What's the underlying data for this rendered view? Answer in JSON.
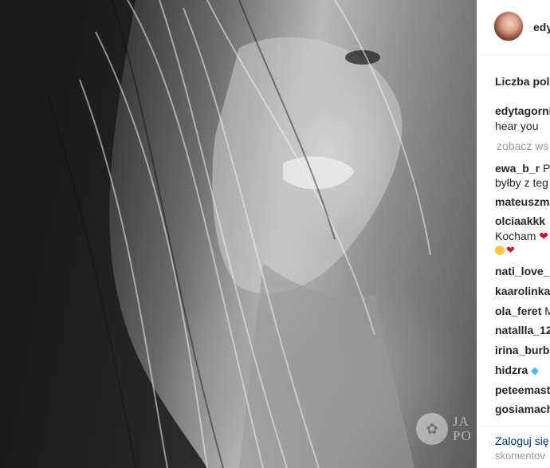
{
  "post": {
    "author_username": "edy",
    "likes_label": "Liczba polu",
    "view_all_label": "zobacz ws",
    "comments": [
      {
        "user": "edytagorni",
        "text": "",
        "line2": "hear you"
      },
      {
        "user": "ewa_b_r",
        "text": "P",
        "line2": "byłby z teg"
      },
      {
        "user": "mateuszma",
        "text": ""
      },
      {
        "user": "olciaakkk",
        "text": "",
        "line2": "Kocham"
      },
      {
        "user": "nati_love_",
        "text": ""
      },
      {
        "user": "kaarolinka",
        "text": ""
      },
      {
        "user": "ola_feret",
        "text": "M"
      },
      {
        "user": "natallla_12",
        "text": ""
      },
      {
        "user": "irina_burbo",
        "text": ""
      },
      {
        "user": "hidzra",
        "text": ""
      },
      {
        "user": "peteemast",
        "text": ""
      },
      {
        "user": "gosiamach",
        "text": ""
      }
    ]
  },
  "footer": {
    "login_label": "Zaloguj się",
    "login_sub": "skomentov"
  },
  "watermark": {
    "line1": "JA",
    "line2": "PO"
  },
  "icons": {
    "heart": "heart-icon",
    "gem": "gem-icon",
    "face": "face-emoji-icon"
  },
  "colors": {
    "link": "#003569",
    "muted": "#999999",
    "text": "#262626",
    "heart": "#c4122f"
  }
}
